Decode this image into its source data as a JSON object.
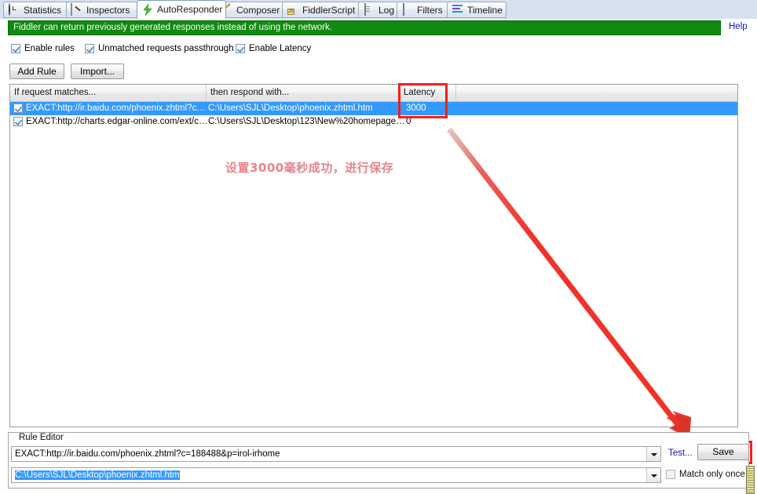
{
  "tabs": [
    {
      "id": "statistics",
      "label": "Statistics",
      "icon": "clock-icon",
      "active": false
    },
    {
      "id": "inspectors",
      "label": "Inspectors",
      "icon": "magnifier-icon",
      "active": false
    },
    {
      "id": "autoresponder",
      "label": "AutoResponder",
      "icon": "bolt-icon",
      "active": true
    },
    {
      "id": "composer",
      "label": "Composer",
      "icon": "pencil-icon",
      "active": false
    },
    {
      "id": "fiddlerscript",
      "label": "FiddlerScript",
      "icon": "js-script-icon",
      "active": false
    },
    {
      "id": "log",
      "label": "Log",
      "icon": "document-icon",
      "active": false
    },
    {
      "id": "filters",
      "label": "Filters",
      "icon": "square-icon",
      "active": false
    },
    {
      "id": "timeline",
      "label": "Timeline",
      "icon": "timeline-icon",
      "active": false
    }
  ],
  "banner": {
    "text": "Fiddler can return previously generated responses instead of using the network.",
    "help_label": "Help",
    "background_color": "#108a10",
    "text_color": "#ffffff",
    "help_color": "#1414c8"
  },
  "options": [
    {
      "id": "enable-rules",
      "label": "Enable rules",
      "checked": true
    },
    {
      "id": "unmatched-passthru",
      "label": "Unmatched requests passthrough",
      "checked": true
    },
    {
      "id": "enable-latency",
      "label": "Enable Latency",
      "checked": true
    }
  ],
  "toolbar": {
    "add_rule_label": "Add Rule",
    "import_label": "Import..."
  },
  "grid": {
    "columns": [
      {
        "id": "match",
        "label": "If request matches..."
      },
      {
        "id": "respond",
        "label": "then respond with..."
      },
      {
        "id": "latency",
        "label": "Latency"
      }
    ],
    "rows": [
      {
        "enabled": true,
        "selected": true,
        "match": "EXACT:http://ir.baidu.com/phoenix.zhtml?c…",
        "respond": "C:\\Users\\SJL\\Desktop\\phoenix.zhtml.htm",
        "latency": "3000"
      },
      {
        "enabled": true,
        "selected": false,
        "match": "EXACT:http://charts.edgar-online.com/ext/c…",
        "respond": "C:\\Users\\SJL\\Desktop\\123\\New%20homepage…",
        "latency": "0"
      }
    ]
  },
  "annotations": {
    "note_text": "设置3000毫秒成功，进行保存",
    "note_color": "#e8848c",
    "highlight_color": "#ff1a1a",
    "arrow_color": "#f0322a",
    "arrow_from": "572,165",
    "arrow_to": "878,560"
  },
  "rule_editor": {
    "legend": "Rule Editor",
    "match_value": "EXACT:http://ir.baidu.com/phoenix.zhtml?c=188488&p=irol-irhome",
    "respond_value": "C:\\Users\\SJL\\Desktop\\phoenix.zhtml.htm",
    "test_label": "Test...",
    "save_label": "Save",
    "match_only_once_label": "Match only once",
    "match_only_once_checked": false
  }
}
